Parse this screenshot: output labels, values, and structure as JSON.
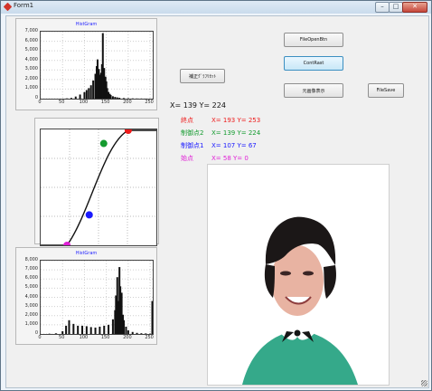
{
  "window": {
    "title": "Form1",
    "controls": {
      "minimize": "–",
      "maximize": "□",
      "close": "✕"
    }
  },
  "histogram_top": {
    "title": "HistGram",
    "chart_data": {
      "type": "bar",
      "title": "HistGram",
      "xlim": [
        0,
        256
      ],
      "ylim": [
        0,
        7000
      ],
      "x_ticks": [
        0,
        50,
        100,
        150,
        200,
        250
      ],
      "y_ticks": [
        0,
        1000,
        2000,
        3000,
        4000,
        5000,
        6000,
        7000
      ],
      "x": [
        60,
        70,
        80,
        90,
        100,
        105,
        110,
        115,
        120,
        125,
        128,
        130,
        133,
        135,
        138,
        140,
        142,
        145,
        148,
        150,
        152,
        155,
        158,
        160,
        165,
        170,
        175,
        180,
        190,
        200,
        210,
        220,
        230,
        240,
        250
      ],
      "values": [
        30,
        80,
        220,
        430,
        680,
        900,
        1100,
        1400,
        1900,
        2600,
        3400,
        4100,
        3100,
        2500,
        2700,
        3600,
        6850,
        3200,
        2300,
        1800,
        1100,
        700,
        500,
        380,
        250,
        180,
        130,
        90,
        60,
        40,
        30,
        20,
        15,
        10,
        5
      ]
    }
  },
  "histogram_bottom": {
    "title": "HistGram",
    "chart_data": {
      "type": "bar",
      "title": "HistGram",
      "xlim": [
        0,
        256
      ],
      "ylim": [
        0,
        8000
      ],
      "x_ticks": [
        0,
        50,
        100,
        150,
        200,
        250
      ],
      "y_ticks": [
        0,
        1000,
        2000,
        3000,
        4000,
        5000,
        6000,
        7000,
        8000
      ],
      "x": [
        20,
        35,
        50,
        58,
        65,
        75,
        85,
        95,
        105,
        115,
        125,
        135,
        145,
        155,
        165,
        170,
        172,
        175,
        178,
        180,
        182,
        185,
        188,
        190,
        195,
        200,
        210,
        220,
        230,
        240,
        250,
        255
      ],
      "values": [
        30,
        70,
        300,
        900,
        1500,
        1100,
        900,
        900,
        850,
        750,
        700,
        800,
        900,
        1000,
        1600,
        2600,
        4200,
        6200,
        3600,
        7300,
        5200,
        4500,
        2100,
        1500,
        800,
        400,
        220,
        120,
        80,
        60,
        40,
        3600
      ]
    }
  },
  "curve": {
    "chart_data": {
      "type": "line",
      "xlim": [
        0,
        255
      ],
      "ylim": [
        0,
        255
      ],
      "points": [
        {
          "label": "始点",
          "x": 58,
          "y": 0,
          "color": "#e01fd6"
        },
        {
          "label": "制御点1",
          "x": 107,
          "y": 67,
          "color": "#1a1aff"
        },
        {
          "label": "制御点2",
          "x": 139,
          "y": 224,
          "color": "#149b2f"
        },
        {
          "label": "終点",
          "x": 193,
          "y": 253,
          "color": "#ee1b1b"
        }
      ]
    }
  },
  "buttons": {
    "reset": "補正ｸﾞﾗﾌﾘｾｯﾄ",
    "open": "FileOpenBtn",
    "contrast": "ContRast",
    "original": "元画像表示",
    "save": "FileSave"
  },
  "coord": "X= 139 Y= 224",
  "info": [
    {
      "label": "終点",
      "value": "X= 193 Y= 253",
      "color": "#ee1b1b"
    },
    {
      "label": "制御点2",
      "value": "X= 139 Y= 224",
      "color": "#149b2f"
    },
    {
      "label": "制御点1",
      "value": "X= 107 Y= 67",
      "color": "#1a1aff"
    },
    {
      "label": "始点",
      "value": "X= 58 Y= 0",
      "color": "#e01fd6"
    }
  ]
}
